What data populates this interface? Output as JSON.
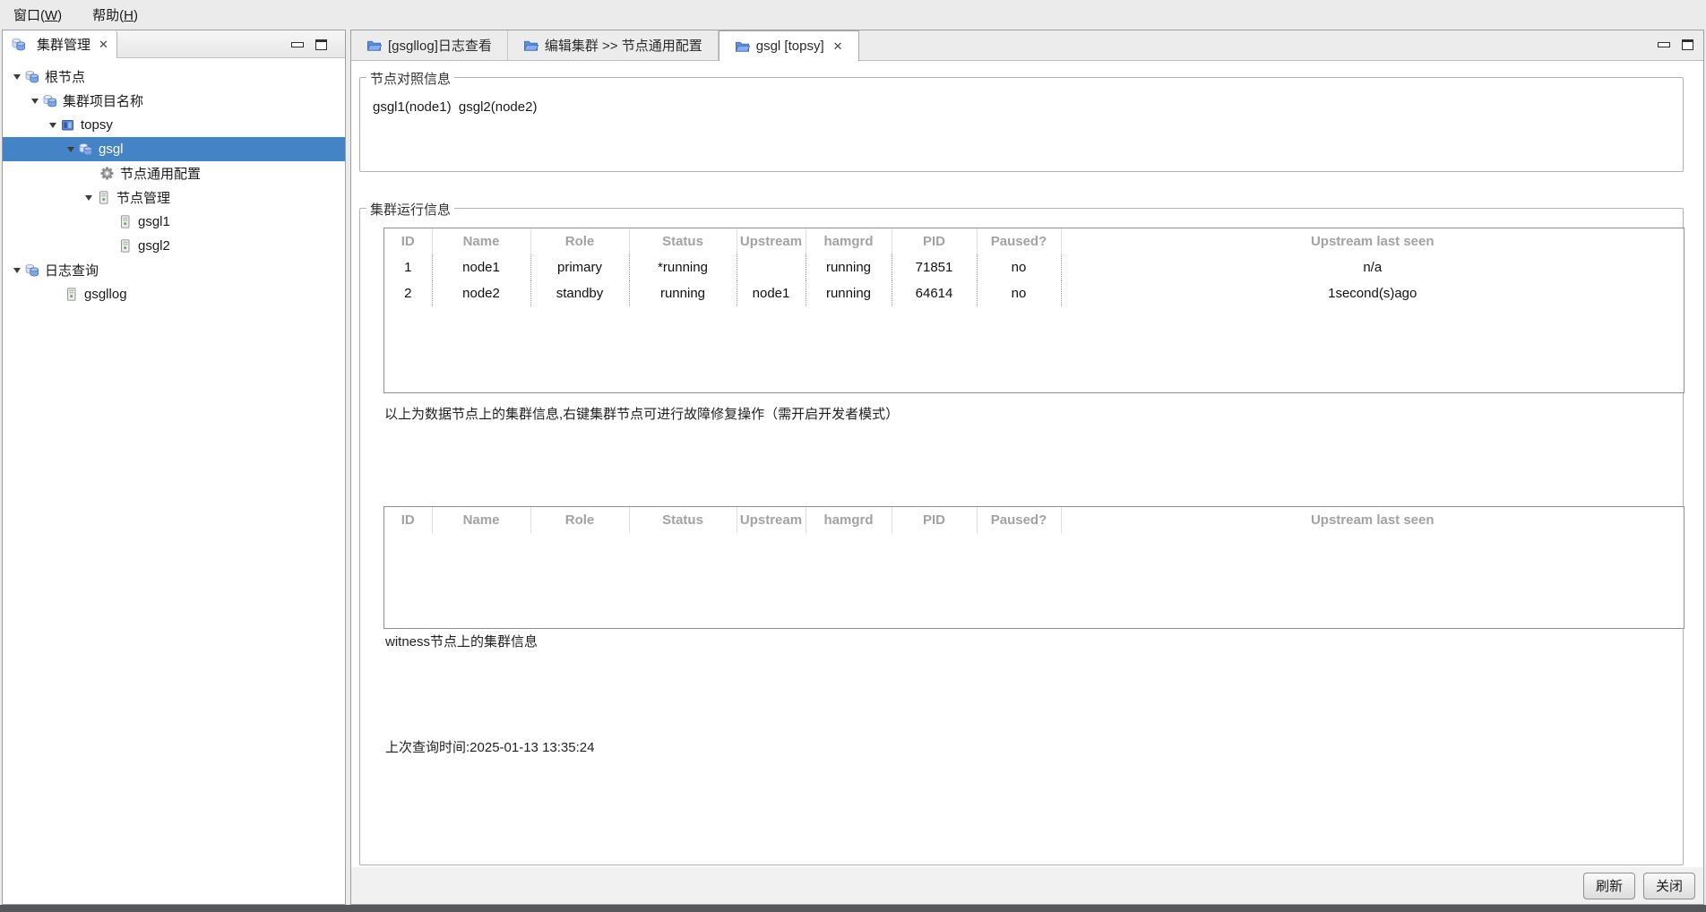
{
  "menu": {
    "items": [
      {
        "pre": "窗口(",
        "key": "W",
        "post": ")"
      },
      {
        "pre": "帮助(",
        "key": "H",
        "post": ")"
      }
    ]
  },
  "left_panel": {
    "title": "集群管理",
    "close_glyph": "✕",
    "tree": [
      {
        "label": "根节点"
      },
      {
        "label": "集群项目名称"
      },
      {
        "label": "topsy"
      },
      {
        "label": "gsgl",
        "selected": true
      },
      {
        "label": "节点通用配置"
      },
      {
        "label": "节点管理"
      },
      {
        "label": "gsgl1"
      },
      {
        "label": "gsgl2"
      },
      {
        "label": "日志查询"
      },
      {
        "label": "gsgllog"
      }
    ]
  },
  "editor": {
    "tabs": [
      {
        "label": "[gsgllog]日志查看"
      },
      {
        "label": "编辑集群 >> 节点通用配置"
      },
      {
        "label": "gsgl [topsy]",
        "close_glyph": "✕",
        "active": true
      }
    ]
  },
  "main": {
    "group_node_info": {
      "title": "节点对照信息",
      "content": "gsgl1(node1)  gsgl2(node2)"
    },
    "group_cluster_info": {
      "title": "集群运行信息"
    },
    "columns": [
      "ID",
      "Name",
      "Role",
      "Status",
      "Upstream",
      "hamgrd",
      "PID",
      "Paused?",
      "Upstream last seen"
    ],
    "data_rows": [
      [
        "1",
        "node1",
        "primary",
        "*running",
        "",
        "running",
        "71851",
        "no",
        "n/a"
      ],
      [
        "2",
        "node2",
        "standby",
        "running",
        "node1",
        "running",
        "64614",
        "no",
        "1second(s)ago"
      ]
    ],
    "data_note": "以上为数据节点上的集群信息,右键集群节点可进行故障修复操作（需开启开发者模式）",
    "witness_note": "witness节点上的集群信息",
    "last_query": "上次查询时间:2025-01-13 13:35:24",
    "refresh_label": "刷新",
    "close_label": "关闭"
  }
}
